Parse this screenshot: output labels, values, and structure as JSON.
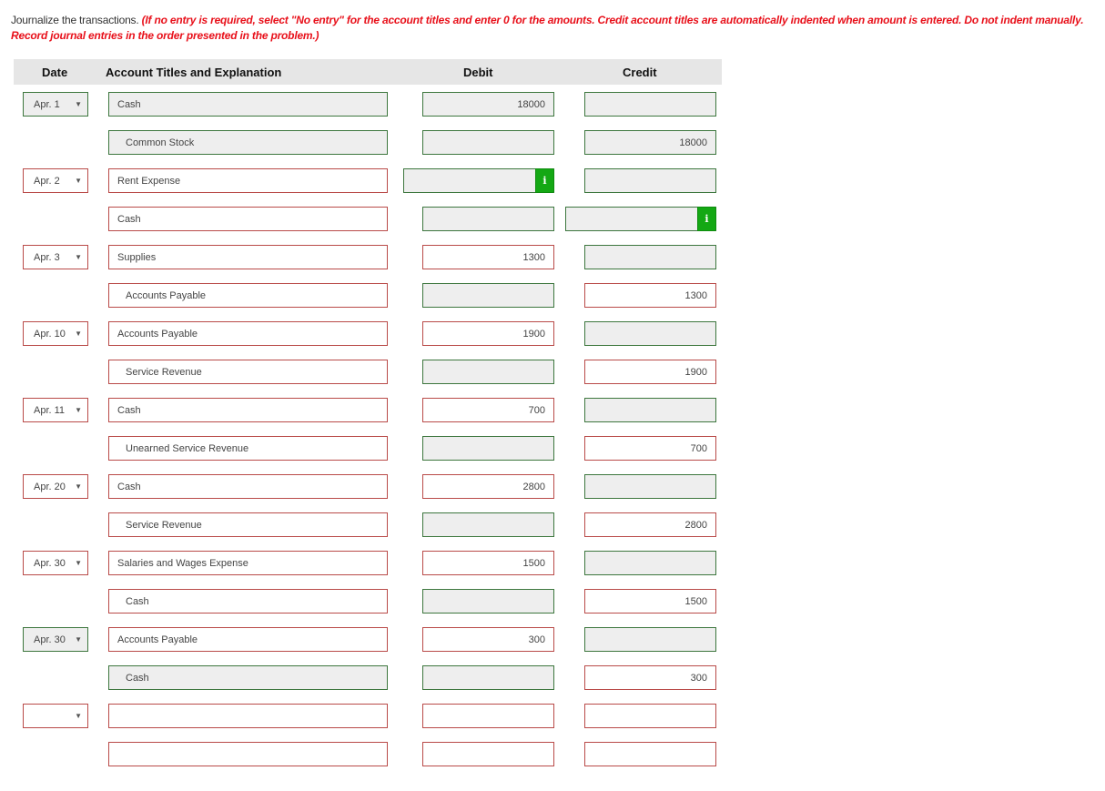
{
  "instructions": {
    "lead": "Journalize the transactions. ",
    "note": "(If no entry is required, select \"No entry\" for the account titles and enter 0 for the amounts. Credit account titles are automatically indented when amount is entered. Do not indent manually. Record journal entries in the order presented in the problem.)"
  },
  "table": {
    "headers": {
      "date": "Date",
      "account": "Account Titles and Explanation",
      "debit": "Debit",
      "credit": "Credit"
    }
  },
  "colors": {
    "correct_border": "#3c763d",
    "incorrect_border": "#b94a48",
    "correct_fill": "#eeeeee",
    "info_badge": "#14a814",
    "note_text": "#e8101a"
  },
  "entries": [
    {
      "date": "Apr. 1",
      "date_status": "correct",
      "lines": [
        {
          "account": "Cash",
          "account_status": "correct",
          "indent": false,
          "debit": "18000",
          "debit_status": "correct",
          "credit": "",
          "credit_status": "correct"
        },
        {
          "account": "Common Stock",
          "account_status": "correct",
          "indent": true,
          "debit": "",
          "debit_status": "correct",
          "credit": "18000",
          "credit_status": "correct"
        }
      ]
    },
    {
      "date": "Apr. 2",
      "date_status": "incorrect",
      "lines": [
        {
          "account": "Rent Expense",
          "account_status": "incorrect",
          "indent": false,
          "debit": "",
          "debit_status": "correct",
          "debit_info": true,
          "credit": "",
          "credit_status": "correct"
        },
        {
          "account": "Cash",
          "account_status": "incorrect",
          "indent": false,
          "debit": "",
          "debit_status": "correct",
          "credit": "",
          "credit_status": "correct",
          "credit_info": true
        }
      ]
    },
    {
      "date": "Apr. 3",
      "date_status": "incorrect",
      "lines": [
        {
          "account": "Supplies",
          "account_status": "incorrect",
          "indent": false,
          "debit": "1300",
          "debit_status": "incorrect",
          "credit": "",
          "credit_status": "correct"
        },
        {
          "account": "Accounts Payable",
          "account_status": "incorrect",
          "indent": true,
          "debit": "",
          "debit_status": "correct",
          "credit": "1300",
          "credit_status": "incorrect"
        }
      ]
    },
    {
      "date": "Apr. 10",
      "date_status": "incorrect",
      "lines": [
        {
          "account": "Accounts Payable",
          "account_status": "incorrect",
          "indent": false,
          "debit": "1900",
          "debit_status": "incorrect",
          "credit": "",
          "credit_status": "correct"
        },
        {
          "account": "Service Revenue",
          "account_status": "incorrect",
          "indent": true,
          "debit": "",
          "debit_status": "correct",
          "credit": "1900",
          "credit_status": "incorrect"
        }
      ]
    },
    {
      "date": "Apr. 11",
      "date_status": "incorrect",
      "lines": [
        {
          "account": "Cash",
          "account_status": "incorrect",
          "indent": false,
          "debit": "700",
          "debit_status": "incorrect",
          "credit": "",
          "credit_status": "correct"
        },
        {
          "account": "Unearned Service Revenue",
          "account_status": "incorrect",
          "indent": true,
          "debit": "",
          "debit_status": "correct",
          "credit": "700",
          "credit_status": "incorrect"
        }
      ]
    },
    {
      "date": "Apr. 20",
      "date_status": "incorrect",
      "lines": [
        {
          "account": "Cash",
          "account_status": "incorrect",
          "indent": false,
          "debit": "2800",
          "debit_status": "incorrect",
          "credit": "",
          "credit_status": "correct"
        },
        {
          "account": "Service Revenue",
          "account_status": "incorrect",
          "indent": true,
          "debit": "",
          "debit_status": "correct",
          "credit": "2800",
          "credit_status": "incorrect"
        }
      ]
    },
    {
      "date": "Apr. 30",
      "date_status": "incorrect",
      "lines": [
        {
          "account": "Salaries and Wages Expense",
          "account_status": "incorrect",
          "indent": false,
          "debit": "1500",
          "debit_status": "incorrect",
          "credit": "",
          "credit_status": "correct"
        },
        {
          "account": "Cash",
          "account_status": "incorrect",
          "indent": true,
          "debit": "",
          "debit_status": "correct",
          "credit": "1500",
          "credit_status": "incorrect"
        }
      ]
    },
    {
      "date": "Apr. 30",
      "date_status": "correct",
      "lines": [
        {
          "account": "Accounts Payable",
          "account_status": "incorrect",
          "indent": false,
          "debit": "300",
          "debit_status": "incorrect",
          "credit": "",
          "credit_status": "correct"
        },
        {
          "account": "Cash",
          "account_status": "correct",
          "indent": true,
          "debit": "",
          "debit_status": "correct",
          "credit": "300",
          "credit_status": "incorrect"
        }
      ]
    },
    {
      "date": "",
      "date_status": "incorrect",
      "lines": [
        {
          "account": "",
          "account_status": "incorrect",
          "indent": false,
          "debit": "",
          "debit_status": "incorrect",
          "credit": "",
          "credit_status": "incorrect"
        },
        {
          "account": "",
          "account_status": "incorrect",
          "indent": false,
          "debit": "",
          "debit_status": "incorrect",
          "credit": "",
          "credit_status": "incorrect"
        }
      ]
    }
  ],
  "icons": {
    "dropdown_caret": "▼",
    "info": "i"
  }
}
